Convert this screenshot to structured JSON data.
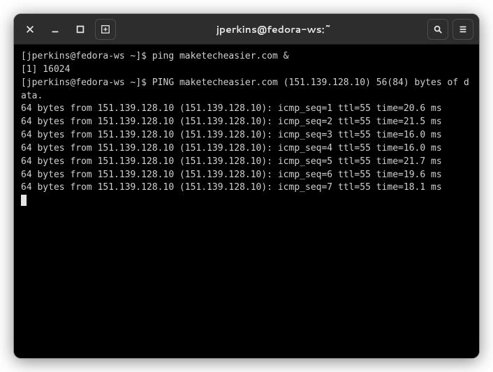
{
  "titlebar": {
    "title": "jperkins@fedora-ws:~"
  },
  "terminal": {
    "prompt": "[jperkins@fedora-ws ~]$ ",
    "command1": "ping maketecheasier.com &",
    "job_line": "[1] 16024",
    "ping_header": "PING maketecheasier.com (151.139.128.10) 56(84) bytes of data.",
    "ping_replies": [
      {
        "seq": 1,
        "ttl": 55,
        "time": "20.6",
        "ip": "151.139.128.10"
      },
      {
        "seq": 2,
        "ttl": 55,
        "time": "21.5",
        "ip": "151.139.128.10"
      },
      {
        "seq": 3,
        "ttl": 55,
        "time": "16.0",
        "ip": "151.139.128.10"
      },
      {
        "seq": 4,
        "ttl": 55,
        "time": "16.0",
        "ip": "151.139.128.10"
      },
      {
        "seq": 5,
        "ttl": 55,
        "time": "21.7",
        "ip": "151.139.128.10"
      },
      {
        "seq": 6,
        "ttl": 55,
        "time": "19.6",
        "ip": "151.139.128.10"
      },
      {
        "seq": 7,
        "ttl": 55,
        "time": "18.1",
        "ip": "151.139.128.10"
      }
    ]
  }
}
